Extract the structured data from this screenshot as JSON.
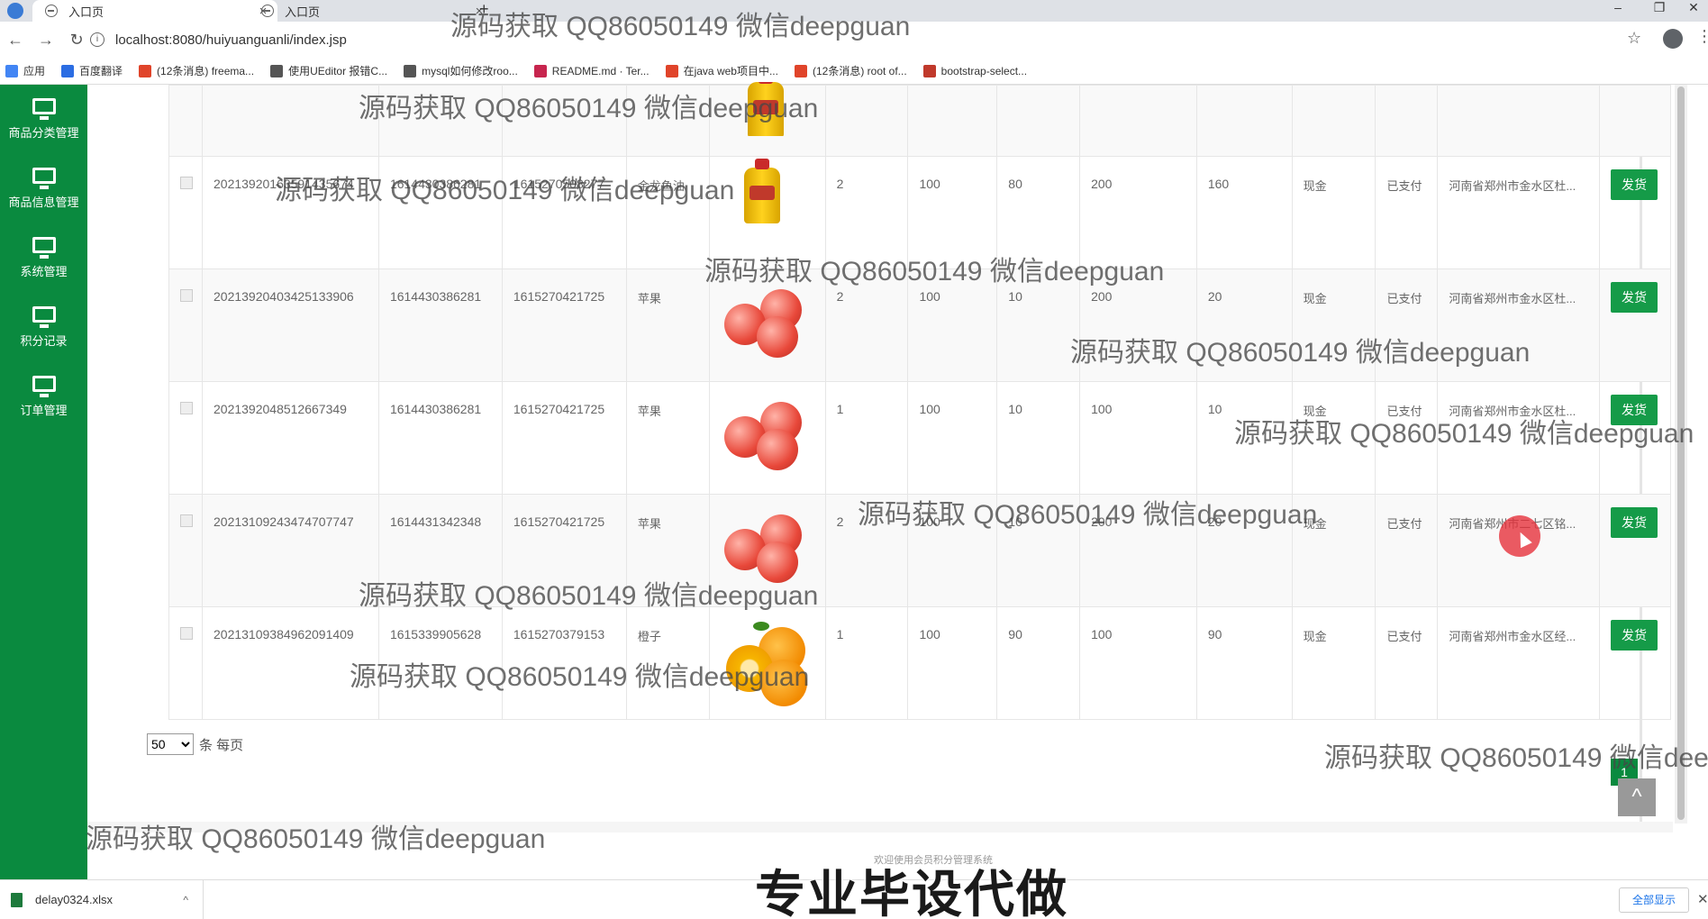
{
  "browser": {
    "tabs": [
      {
        "title": "入口页",
        "close": "×"
      },
      {
        "title": "入口页",
        "close": "×"
      }
    ],
    "new_tab": "+",
    "window_controls": [
      "–",
      "❐",
      "✕"
    ],
    "url": "localhost:8080/huiyuanguanli/index.jsp",
    "nav": {
      "back": "←",
      "forward": "→",
      "reload": "↻"
    },
    "info_icon": "i",
    "star": "☆",
    "menu": "⋮",
    "bookmarks": [
      {
        "label": "应用",
        "color": "#4285f4"
      },
      {
        "label": "百度翻译",
        "color": "#2b6de3"
      },
      {
        "label": "(12条消息) freema...",
        "color": "#e0442a"
      },
      {
        "label": "使用UEditor 报错C...",
        "color": "#555555"
      },
      {
        "label": "mysql如何修改roo...",
        "color": "#555555"
      },
      {
        "label": "README.md · Ter...",
        "color": "#c7254e"
      },
      {
        "label": "在java web项目中...",
        "color": "#e0442a"
      },
      {
        "label": "(12条消息) root of...",
        "color": "#e0442a"
      },
      {
        "label": "bootstrap-select...",
        "color": "#c0392b"
      }
    ]
  },
  "sidebar": {
    "items": [
      {
        "label": "商品分类管理"
      },
      {
        "label": "商品信息管理"
      },
      {
        "label": "系统管理"
      },
      {
        "label": "积分记录"
      },
      {
        "label": "订单管理"
      }
    ]
  },
  "orders": {
    "ship_label": "发货",
    "rows": [
      {
        "order_no": "20213920163591435674",
        "user_id": "1614430386281",
        "product_id": "1615270508277",
        "product": "金龙鱼油",
        "image": "oil",
        "qty": "2",
        "price": "100",
        "points": "80",
        "total": "200",
        "total_points": "160",
        "pay_method": "现金",
        "status": "已支付",
        "address": "河南省郑州市金水区杜..."
      },
      {
        "order_no": "20213920403425133906",
        "user_id": "1614430386281",
        "product_id": "1615270421725",
        "product": "苹果",
        "image": "apple",
        "qty": "2",
        "price": "100",
        "points": "10",
        "total": "200",
        "total_points": "20",
        "pay_method": "现金",
        "status": "已支付",
        "address": "河南省郑州市金水区杜..."
      },
      {
        "order_no": "2021392048512667349",
        "user_id": "1614430386281",
        "product_id": "1615270421725",
        "product": "苹果",
        "image": "apple",
        "qty": "1",
        "price": "100",
        "points": "10",
        "total": "100",
        "total_points": "10",
        "pay_method": "现金",
        "status": "已支付",
        "address": "河南省郑州市金水区杜..."
      },
      {
        "order_no": "20213109243474707747",
        "user_id": "1614431342348",
        "product_id": "1615270421725",
        "product": "苹果",
        "image": "apple",
        "qty": "2",
        "price": "100",
        "points": "10",
        "total": "200",
        "total_points": "20",
        "pay_method": "现金",
        "status": "已支付",
        "address": "河南省郑州市二七区铭..."
      },
      {
        "order_no": "20213109384962091409",
        "user_id": "1615339905628",
        "product_id": "1615270379153",
        "product": "橙子",
        "image": "orange",
        "qty": "1",
        "price": "100",
        "points": "90",
        "total": "100",
        "total_points": "90",
        "pay_method": "现金",
        "status": "已支付",
        "address": "河南省郑州市金水区经..."
      }
    ]
  },
  "pager": {
    "page_size": "50",
    "per_page_label": "条 每页",
    "current_page": "1",
    "back_top": "^"
  },
  "footer": {
    "text": "欢迎使用会员积分管理系统"
  },
  "downloads": {
    "file": "delay0324.xlsx",
    "chevron": "^",
    "show_all": "全部显示",
    "close": "✕"
  },
  "overlay": {
    "watermark": "源码获取 QQ86050149 微信deepguan",
    "caption": "专业毕设代做"
  }
}
